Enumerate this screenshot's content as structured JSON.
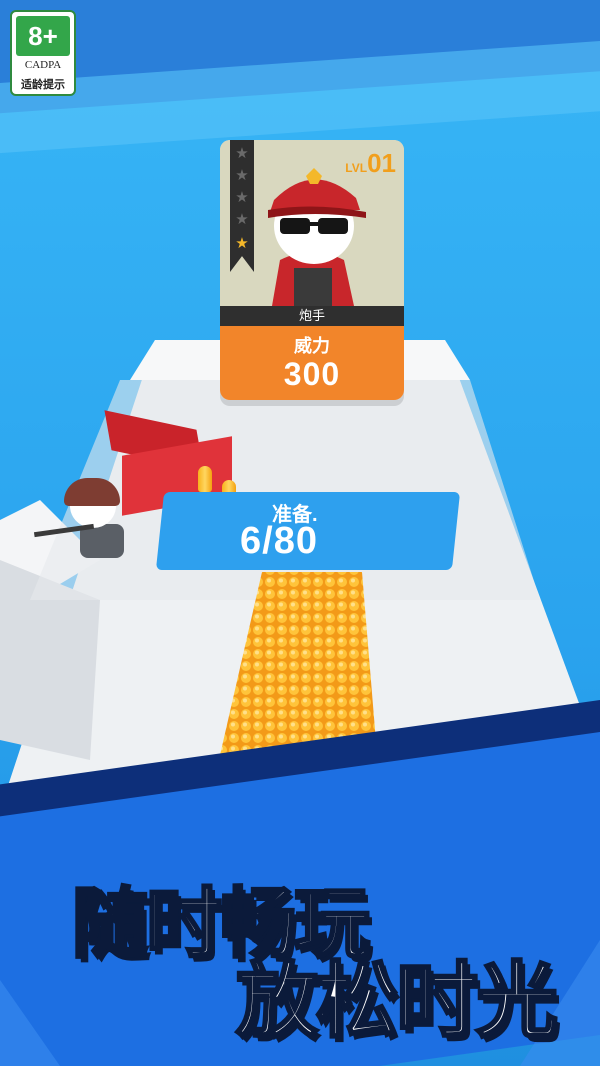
{
  "age_badge": {
    "rating": "8+",
    "org": "CADPA",
    "hint": "适龄提示"
  },
  "unit_card": {
    "level_prefix": "LVL",
    "level": "01",
    "stars_total": 5,
    "stars_active": 1,
    "name": "炮手",
    "power_label": "威力",
    "power_value": "300"
  },
  "ready_panel": {
    "label": "准备.",
    "count_text": "6/80"
  },
  "slogan": {
    "line1": "随时畅玩",
    "line2": "放松时光"
  },
  "colors": {
    "sky": "#2fa9ef",
    "card_orange": "#f2852a",
    "level_gold": "#f19f1c",
    "ready_blue": "#2ea0ee",
    "bullet_gold": "#f8b21a",
    "crate_red": "#e0333a",
    "age_green": "#33a64a",
    "slogan_band": "#1d6fe2"
  }
}
